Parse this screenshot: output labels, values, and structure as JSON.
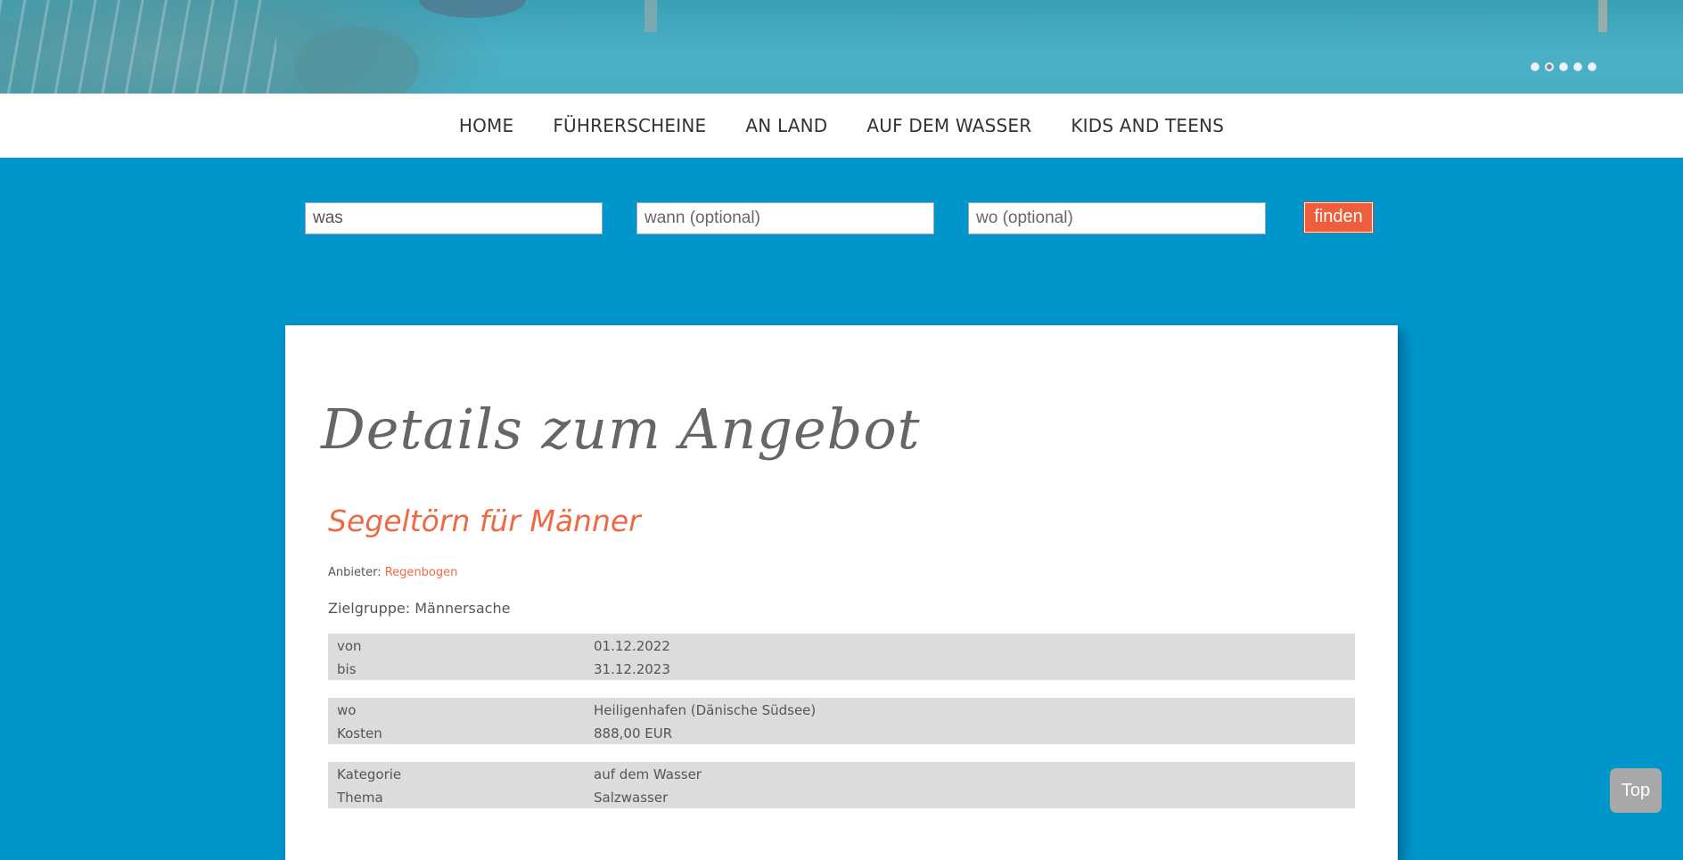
{
  "slider": {
    "dot_count": 5,
    "active_index": 1
  },
  "nav": {
    "items": [
      "HOME",
      "FÜHRERSCHEINE",
      "AN LAND",
      "AUF DEM WASSER",
      "KIDS AND TEENS"
    ]
  },
  "search": {
    "what_value": "was",
    "when_placeholder": "wann (optional)",
    "where_placeholder": "wo (optional)",
    "button_label": "finden"
  },
  "details": {
    "page_title": "Details zum Angebot",
    "offer_title": "Segeltörn für Männer",
    "provider_label": "Anbieter:",
    "provider_name": "Regenbogen",
    "target_group": "Zielgruppe: Männersache",
    "groups": [
      [
        {
          "key": "von",
          "value": "01.12.2022"
        },
        {
          "key": "bis",
          "value": "31.12.2023"
        }
      ],
      [
        {
          "key": "wo",
          "value": "Heiligenhafen (Dänische Südsee)"
        },
        {
          "key": "Kosten",
          "value": "888,00 EUR"
        }
      ],
      [
        {
          "key": "Kategorie",
          "value": "auf dem Wasser"
        },
        {
          "key": "Thema",
          "value": "Salzwasser"
        }
      ]
    ]
  },
  "top_button": "Top",
  "colors": {
    "background": "#0096cc",
    "accent": "#ee6a45",
    "button": "#ee5e3c"
  }
}
